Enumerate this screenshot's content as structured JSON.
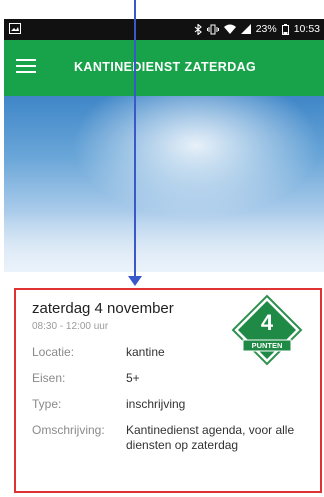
{
  "status_bar": {
    "time": "10:53",
    "battery": "23%",
    "icons": [
      "image-icon",
      "bluetooth-icon",
      "vibrate-icon",
      "wifi-icon",
      "signal-icon",
      "battery-icon"
    ]
  },
  "app_bar": {
    "title": "KANTINEDIENST ZATERDAG",
    "menu_icon": "hamburger-menu-icon",
    "color": "#18a34a"
  },
  "event": {
    "date": "zaterdag 4 november",
    "time": "08:30 - 12:00 uur",
    "points": "4",
    "points_label": "PUNTEN",
    "details": [
      {
        "label": "Locatie:",
        "value": "kantine"
      },
      {
        "label": "Eisen:",
        "value": "5+"
      },
      {
        "label": "Type:",
        "value": "inschrijving"
      },
      {
        "label": "Omschrijving:",
        "value": "Kantinedienst agenda, voor alle diensten op zaterdag"
      }
    ]
  },
  "annotation": {
    "arrow_color": "#3a58c8",
    "highlight_color": "#e03232"
  }
}
